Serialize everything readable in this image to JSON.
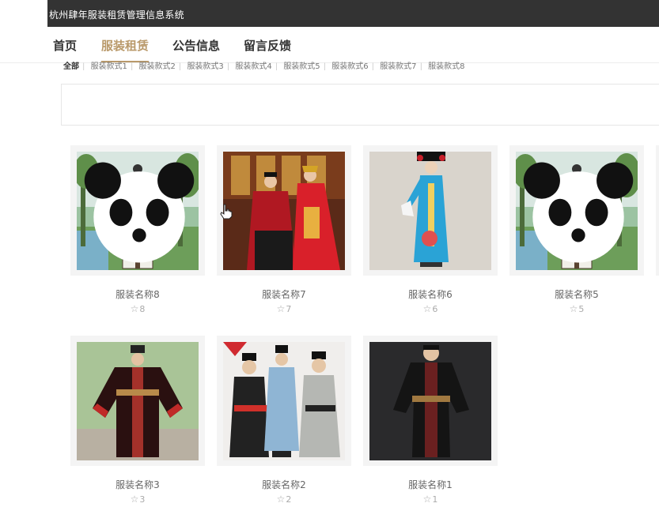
{
  "header": {
    "system_title": "杭州肆年服装租赁管理信息系统"
  },
  "nav": {
    "items": [
      {
        "label": "首页",
        "active": false
      },
      {
        "label": "服装租赁",
        "active": true
      },
      {
        "label": "公告信息",
        "active": false
      },
      {
        "label": "留言反馈",
        "active": false
      }
    ]
  },
  "filters": [
    "全部",
    "服装款式1",
    "服装款式2",
    "服装款式3",
    "服装款式4",
    "服装款式5",
    "服装款式6",
    "服装款式7",
    "服装款式8"
  ],
  "products": [
    {
      "name": "服装名称8",
      "likes": "8",
      "image": "white-hanfu-garden"
    },
    {
      "name": "服装名称7",
      "likes": "7",
      "image": "red-wedding-couple"
    },
    {
      "name": "服装名称6",
      "likes": "6",
      "image": "blue-qing-dress"
    },
    {
      "name": "服装名称5",
      "likes": "5",
      "image": "white-hanfu-garden"
    },
    {
      "name": "服装名称3",
      "likes": "3",
      "image": "black-red-official-robe"
    },
    {
      "name": "服装名称2",
      "likes": "2",
      "image": "three-hanfu-group"
    },
    {
      "name": "服装名称1",
      "likes": "1",
      "image": "black-hanfu-man"
    }
  ],
  "colors": {
    "topbar": "#333333",
    "accent": "#b9996a"
  }
}
